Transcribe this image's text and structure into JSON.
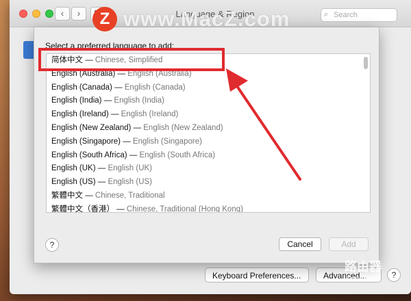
{
  "window": {
    "title": "Language & Region",
    "search_placeholder": "Search"
  },
  "toolbar": {
    "back_glyph": "‹",
    "forward_glyph": "›"
  },
  "sheet": {
    "prompt": "Select a preferred language to add:",
    "languages": [
      {
        "native": "简体中文",
        "english": "Chinese, Simplified"
      },
      {
        "native": "English (Australia)",
        "english": "English (Australia)"
      },
      {
        "native": "English (Canada)",
        "english": "English (Canada)"
      },
      {
        "native": "English (India)",
        "english": "English (India)"
      },
      {
        "native": "English (Ireland)",
        "english": "English (Ireland)"
      },
      {
        "native": "English (New Zealand)",
        "english": "English (New Zealand)"
      },
      {
        "native": "English (Singapore)",
        "english": "English (Singapore)"
      },
      {
        "native": "English (South Africa)",
        "english": "English (South Africa)"
      },
      {
        "native": "English (UK)",
        "english": "English (UK)"
      },
      {
        "native": "English (US)",
        "english": "English (US)"
      },
      {
        "native": "繁體中文",
        "english": "Chinese, Traditional"
      },
      {
        "native": "繁體中文（香港）",
        "english": "Chinese, Traditional (Hong Kong)"
      }
    ],
    "separator": "—",
    "help_label": "?",
    "cancel_label": "Cancel",
    "add_label": "Add"
  },
  "bottom": {
    "keyboard_prefs_label": "Keyboard Preferences...",
    "advanced_label": "Advanced...",
    "help_label": "?"
  },
  "watermark": {
    "logo_letter": "Z",
    "site_text": "www.MacZ.com",
    "corner_big": "路由器",
    "corner_small": "luyouqi.com"
  },
  "colors": {
    "annotation_red": "#e02b2f"
  }
}
